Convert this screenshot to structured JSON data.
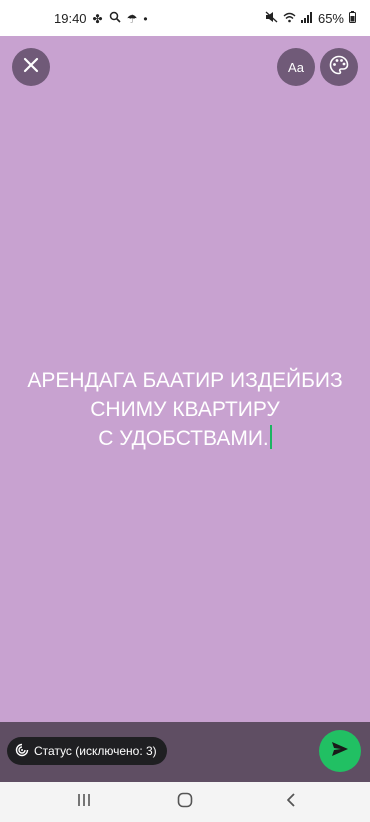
{
  "status_bar": {
    "time": "19:40",
    "battery": "65%",
    "icons": [
      "fan-icon",
      "search-icon",
      "umbrella-icon",
      "dot-icon",
      "mute-icon",
      "wifi-icon",
      "signal-icon",
      "battery-icon"
    ]
  },
  "toolbar": {
    "close_icon": "close-icon",
    "font_label": "Aa",
    "palette_icon": "palette-icon"
  },
  "editor": {
    "line1": "АРЕНДАГА БААТИР ИЗДЕЙБИЗ",
    "line2": "СНИМУ КВАРТИРУ",
    "line3": "С УДОБСТВАМИ.",
    "background_color": "#c8a2d0",
    "cursor_color": "#1db462"
  },
  "bottom": {
    "privacy_label": "Статус (исключено: 3)",
    "send_icon": "send-icon",
    "send_color": "#21c063"
  },
  "nav": {
    "items": [
      "recent-apps-icon",
      "home-icon",
      "back-icon"
    ]
  }
}
